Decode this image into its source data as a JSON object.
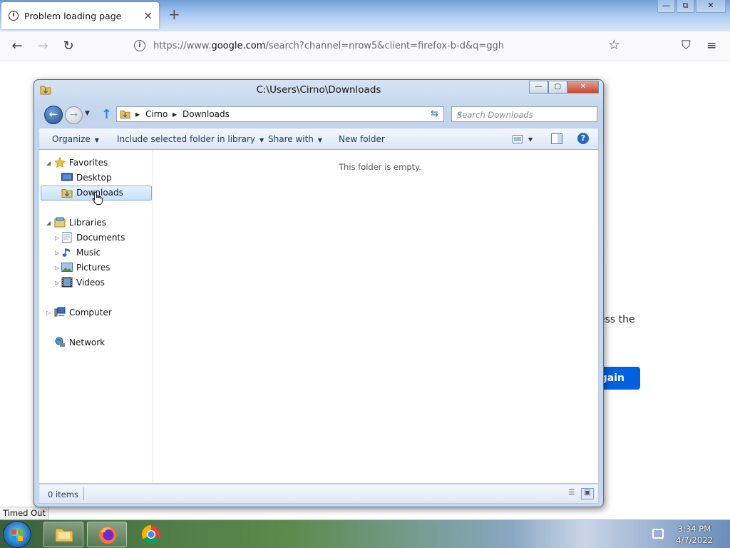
{
  "browser": {
    "tab": {
      "title": "Problem loading page",
      "close": "×",
      "info": "i"
    },
    "new_tab": "+",
    "window_controls": {
      "minimize": "—",
      "restore": "⧉",
      "close": "✕"
    },
    "nav": {
      "back": "←",
      "forward": "→",
      "reload": "↻"
    },
    "url": {
      "prefix": "https://www.",
      "domain": "google.com",
      "rest": "/search?channel=nrow5&client=firefox-b-d&q=ggh"
    },
    "bookmark_icon": "☆",
    "pocket_icon": "⛉",
    "menu_icon": "≡"
  },
  "page": {
    "fragment_text": "ess the",
    "try_again_partial": "gain",
    "status_text": "Timed Out"
  },
  "explorer": {
    "title": "C:\\Users\\Cirno\\Downloads",
    "controls": {
      "minimize": "—",
      "maximize": "▢",
      "close": "✕"
    },
    "back": "←",
    "forward": "→",
    "history_dropdown": "▼",
    "up": "↑",
    "breadcrumb": [
      "Cirno",
      "Downloads"
    ],
    "breadcrumb_sep": "▶",
    "address_dropdown": "▼",
    "refresh": "⇆",
    "search_placeholder": "Search Downloads",
    "search_icon": "⌕",
    "commands": {
      "organize": "Organize",
      "include": "Include selected folder in library",
      "share": "Share with",
      "new_folder": "New folder",
      "dropdown": "▼",
      "help": "?"
    },
    "nav_pane": {
      "favorites": "Favorites",
      "desktop": "Desktop",
      "downloads": "Downloads",
      "libraries": "Libraries",
      "documents": "Documents",
      "music": "Music",
      "pictures": "Pictures",
      "videos": "Videos",
      "computer": "Computer",
      "network": "Network",
      "expanded": "◢",
      "collapsed": "▷"
    },
    "empty_message": "This folder is empty.",
    "status": "0 items"
  },
  "taskbar": {
    "time": "3:34 PM",
    "date": "4/7/2022"
  }
}
